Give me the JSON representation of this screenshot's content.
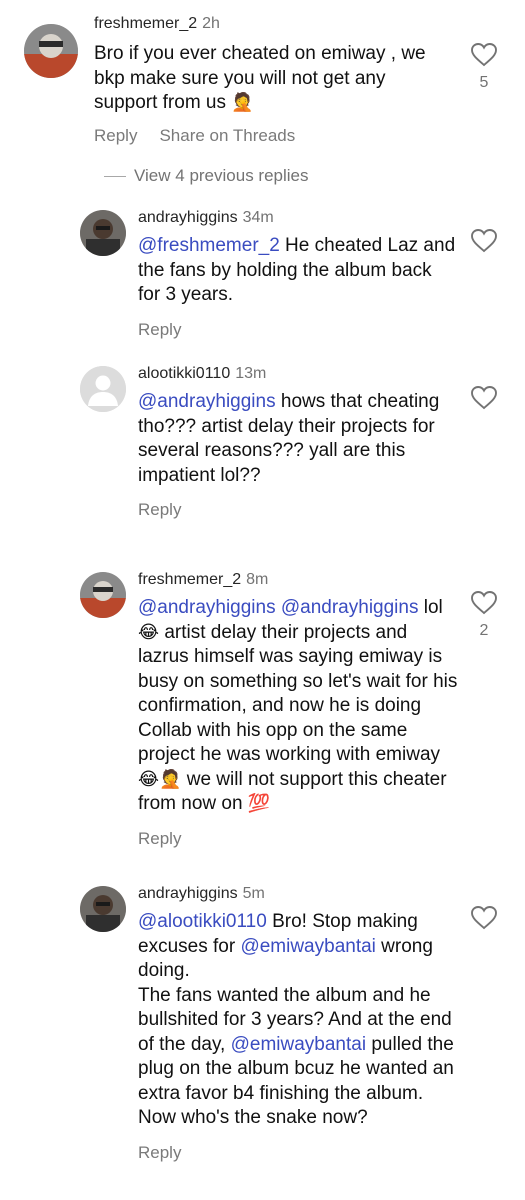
{
  "comments": [
    {
      "username": "freshmemer_2",
      "time": "2h",
      "text_parts": [
        "Bro if you ever cheated on emiway , we bkp make sure you will not get any support from us ",
        "🤦"
      ],
      "actions": [
        "Reply",
        "Share on Threads"
      ],
      "likes": "5"
    }
  ],
  "view_replies_label": "View 4 previous replies",
  "replies": [
    {
      "username": "andrayhiggins",
      "time": "34m",
      "mention": "@freshmemer_2",
      "text": " He cheated Laz and the fans by holding the album back for 3 years.",
      "reply_label": "Reply",
      "likes": ""
    },
    {
      "username": "alootikki0110",
      "time": "13m",
      "mention": "@andrayhiggins",
      "text": " hows that cheating tho??? artist delay their projects for several reasons??? yall are this impatient lol??",
      "reply_label": "Reply",
      "likes": ""
    },
    {
      "username": "freshmemer_2",
      "time": "8m",
      "mention": "@andrayhiggins @andrayhiggins",
      "text_a": " lol ",
      "emoji_a": "😂",
      "text_b": " artist delay their projects and lazrus himself was saying emiway is busy on something so let's wait for his confirmation, and now he is doing Collab with his opp on the same project he was working with emiway ",
      "emoji_b": "😂🤦",
      "text_c": " we will not support this cheater from now on ",
      "emoji_c": "💯",
      "reply_label": "Reply",
      "likes": "2"
    },
    {
      "username": "andrayhiggins",
      "time": "5m",
      "mention": "@alootikki0110",
      "text_a": " Bro! Stop making excuses for ",
      "mention_b": "@emiwaybantai",
      "text_b": " wrong doing.",
      "text_c": "The fans wanted the album and he bullshited for 3 years? And at the end of the day, ",
      "mention_c": "@emiwaybantai",
      "text_d": " pulled the plug on the album bcuz he wanted an extra favor b4 finishing the album. Now who's the snake now?",
      "reply_label": "Reply",
      "likes": ""
    }
  ]
}
